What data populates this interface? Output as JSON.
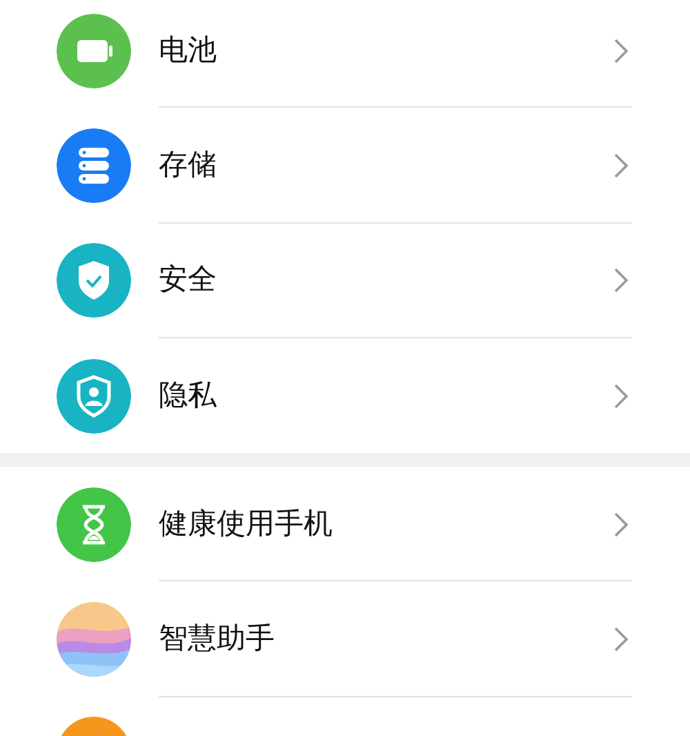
{
  "groups": [
    {
      "items": [
        {
          "kind": "battery",
          "color": "#5cc04f",
          "label": "电池"
        },
        {
          "kind": "storage",
          "color": "#1a7cf5",
          "label": "存储"
        },
        {
          "kind": "security",
          "color": "#19b4c4",
          "label": "安全"
        },
        {
          "kind": "privacy",
          "color": "#19b4c4",
          "label": "隐私"
        }
      ]
    },
    {
      "items": [
        {
          "kind": "health",
          "color": "#43c548",
          "label": "健康使用手机"
        },
        {
          "kind": "assistant",
          "label": "智慧助手"
        },
        {
          "kind": "partial",
          "color": "#f7961c"
        }
      ]
    }
  ]
}
